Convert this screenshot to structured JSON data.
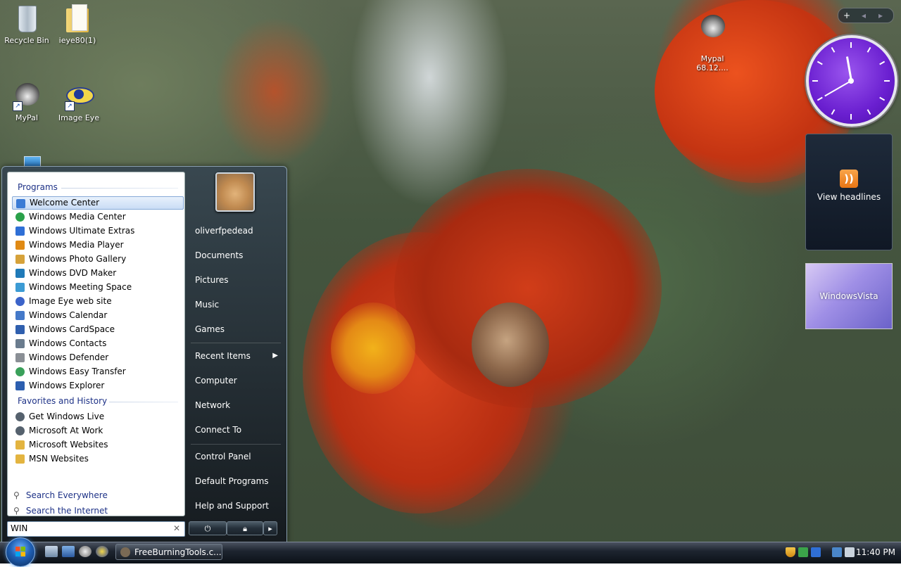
{
  "desktop": {
    "icons": [
      {
        "label": "Recycle Bin",
        "icon": "recycle-bin-icon"
      },
      {
        "label": "ieye80(1)",
        "icon": "folder-icon"
      },
      {
        "label": "MyPal",
        "icon": "raccoon-icon"
      },
      {
        "label": "Image Eye",
        "icon": "eye-icon"
      },
      {
        "label": "Mypal\n68.12....",
        "icon": "raccoon-icon"
      }
    ]
  },
  "gadgets": {
    "sidebar_controls": [
      "+",
      "◂",
      "▸"
    ],
    "clock": {
      "time": "11:40"
    },
    "feed_label": "View headlines",
    "slideshow_label": "WindowsVista"
  },
  "start_menu": {
    "programs_header": "Programs",
    "programs": [
      {
        "label": "Welcome Center",
        "selected": true,
        "color": "#3a7bd5"
      },
      {
        "label": "Windows Media Center",
        "color": "#2aa14a"
      },
      {
        "label": "Windows Ultimate Extras",
        "color": "#2f6fd6"
      },
      {
        "label": "Windows Media Player",
        "color": "#e08a14"
      },
      {
        "label": "Windows Photo Gallery",
        "color": "#d6a23a"
      },
      {
        "label": "Windows DVD Maker",
        "color": "#1f7ab8"
      },
      {
        "label": "Windows Meeting Space",
        "color": "#3c9bd4"
      },
      {
        "label": "Image Eye web site",
        "color": "#3b63c9"
      },
      {
        "label": "Windows Calendar",
        "color": "#4479c9"
      },
      {
        "label": "Windows CardSpace",
        "color": "#2f5fae"
      },
      {
        "label": "Windows Contacts",
        "color": "#6a7c8e"
      },
      {
        "label": "Windows Defender",
        "color": "#8a8f95"
      },
      {
        "label": "Windows Easy Transfer",
        "color": "#3aa05a"
      },
      {
        "label": "Windows Explorer",
        "color": "#2c5fb0"
      }
    ],
    "favorites_header": "Favorites and History",
    "favorites": [
      {
        "label": "Get Windows Live",
        "color": "#55616d"
      },
      {
        "label": "Microsoft At Work",
        "color": "#55616d"
      },
      {
        "label": "Microsoft Websites",
        "color": "#e3b440"
      },
      {
        "label": "MSN Websites",
        "color": "#e3b440"
      }
    ],
    "search_links": [
      "Search Everywhere",
      "Search the Internet"
    ],
    "search_value": "WIN",
    "user_name": "oliverfpedead",
    "right_links": {
      "group1": [
        "Documents",
        "Pictures",
        "Music",
        "Games"
      ],
      "recent": "Recent Items",
      "group2": [
        "Computer",
        "Network",
        "Connect To"
      ],
      "group3": [
        "Control Panel",
        "Default Programs",
        "Help and Support"
      ]
    },
    "power": {
      "power_icon": "power-icon",
      "lock_icon": "lock-icon",
      "arrow": "▸"
    }
  },
  "taskbar": {
    "task_label": "FreeBurningTools.c...",
    "time": "11:40 PM"
  }
}
